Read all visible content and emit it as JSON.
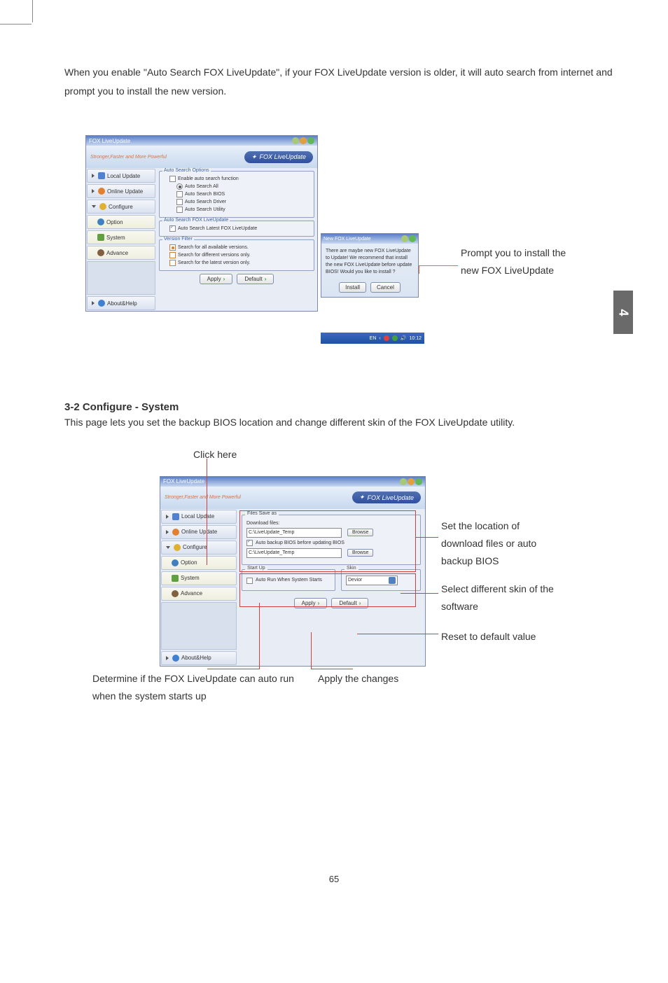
{
  "intro": "When you enable \"Auto Search FOX LiveUpdate\", if your FOX LiveUpdate version is older, it will auto search from internet and prompt you to install the new version.",
  "pageTab": "4",
  "pageNum": "65",
  "fig1": {
    "title": "FOX LiveUpdate",
    "slogan": "Stronger,Faster and More Powerful",
    "product": "FOX LiveUpdate",
    "sidebar": {
      "local": "Local Update",
      "online": "Online Update",
      "configure": "Configure",
      "option": "Option",
      "system": "System",
      "advance": "Advance",
      "about": "About&Help"
    },
    "fs1": {
      "title": "Auto Search Options",
      "enable": "Enable auto search function",
      "all": "Auto Search All",
      "bios": "Auto Search BIOS",
      "driver": "Auto Search Driver",
      "utility": "Auto Search Utility"
    },
    "fs2": {
      "title": "Auto Search FOX LiveUpdate",
      "latest": "Auto Search Latest FOX LiveUpdate"
    },
    "fs3": {
      "title": "Version Filter",
      "all": "Search for all available versions.",
      "different": "Search for different versions only.",
      "latest": "Search for the latest version only."
    },
    "apply": "Apply",
    "default": "Default",
    "dialog": {
      "title": "New FOX LiveUpdate",
      "body": "There are maybe new FOX LiveUpdate to Update! We recommend that install the new FOX LiveUpdate before update BIOS! Would you like to install ?",
      "install": "Install",
      "cancel": "Cancel"
    },
    "taskbar": {
      "lang": "EN",
      "time": "10:12"
    },
    "callout": "Prompt you to install the new FOX LiveUpdate"
  },
  "section2": {
    "heading": "3-2 Configure - System",
    "text": "This page lets you set the backup BIOS location and change different skin of the FOX LiveUpdate utility."
  },
  "fig2": {
    "clickHere": "Click here",
    "title": "FOX LiveUpdate",
    "slogan": "Stronger,Faster and More Powerful",
    "product": "FOX LiveUpdate",
    "sidebar": {
      "local": "Local Update",
      "online": "Online Update",
      "configure": "Configure",
      "option": "Option",
      "system": "System",
      "advance": "Advance",
      "about": "About&Help"
    },
    "filesSave": {
      "title": "Files Save as",
      "downloadLabel": "Download files:",
      "path1": "C:\\LiveUpdate_Temp",
      "autobackup": "Auto backup BIOS before updating BIOS",
      "path2": "C:\\LiveUpdate_Temp",
      "browse": "Browse"
    },
    "startup": {
      "title": "Start Up",
      "autorun": "Auto Run When System Starts"
    },
    "skin": {
      "title": "Skin",
      "value": "Devior"
    },
    "apply": "Apply",
    "default": "Default",
    "callouts": {
      "setLocation": "Set the location of download files or auto backup BIOS",
      "selectSkin": "Select different skin of the software",
      "reset": "Reset to default value",
      "determine": "Determine if the FOX LiveUpdate can auto run when the system starts up",
      "applyChanges": "Apply the changes"
    }
  }
}
